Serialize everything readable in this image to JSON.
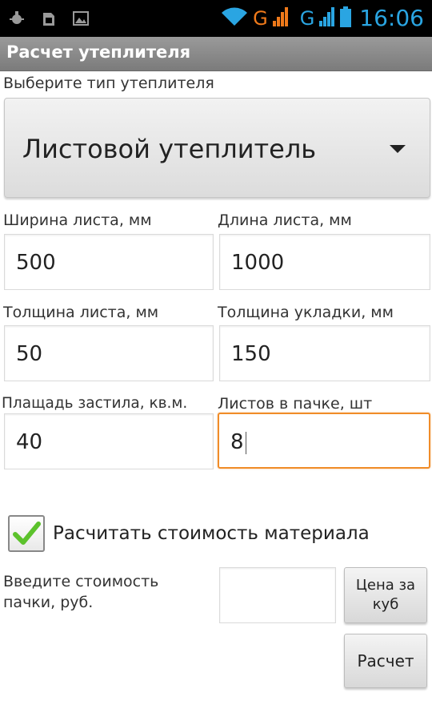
{
  "status_bar": {
    "time": "16:06",
    "network_1": "G",
    "network_2": "G",
    "icons": [
      "usb-debug-icon",
      "sim-icon",
      "image-icon",
      "wifi-icon",
      "signal-icon",
      "battery-icon"
    ]
  },
  "title": "Расчет утеплителя",
  "insulation_type": {
    "label": "Выберите тип утеплителя",
    "selected": "Листовой утеплитель"
  },
  "fields": {
    "sheet_width": {
      "label": "Ширина листа, мм",
      "value": "500"
    },
    "sheet_length": {
      "label": "Длина листа, мм",
      "value": "1000"
    },
    "sheet_thickness": {
      "label": "Толщина листа, мм",
      "value": "50"
    },
    "laying_thickness": {
      "label": "Толщина укладки, мм",
      "value": "150"
    },
    "floor_area": {
      "label": "Плащадь застила, кв.м.",
      "value": "40"
    },
    "sheets_per_pack": {
      "label": "Листов в пачке, шт",
      "value": "8"
    }
  },
  "calc_cost": {
    "label": "Расчитать стоимость материала",
    "checked": true
  },
  "pack_price": {
    "label": "Введите стоимость пачки, руб.",
    "value": ""
  },
  "buttons": {
    "price_per_cube": "Цена за куб",
    "calculate": "Расчет"
  },
  "colors": {
    "clock": "#2aa5e2",
    "network": "#f07a1a",
    "focus_border": "#f08c28",
    "checkmark": "#5cc22c"
  }
}
